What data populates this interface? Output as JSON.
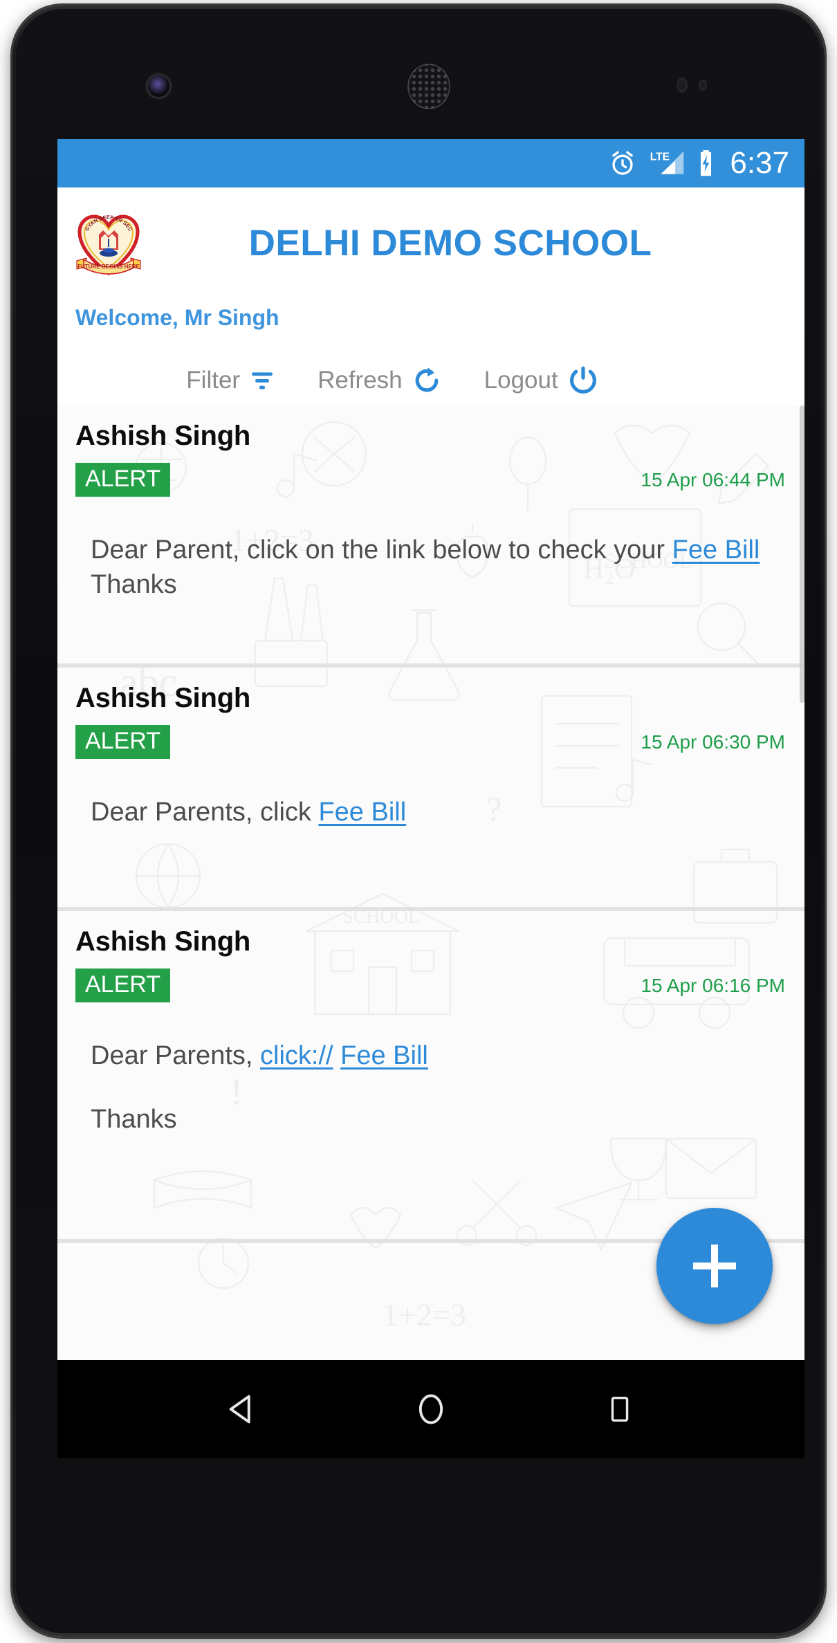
{
  "device": {
    "hardware": {
      "front_camera": "front-camera",
      "earpiece": "earpiece-speaker",
      "proximity_sensor": "proximity-sensor",
      "light_sensor": "light-sensor"
    }
  },
  "status_bar": {
    "background_color": "#3190d9",
    "clock": "6:37",
    "icons": [
      {
        "name": "alarm-icon",
        "label": "alarm"
      },
      {
        "name": "lte-signal-icon",
        "label": "LTE"
      },
      {
        "name": "battery-charging-icon",
        "label": "battery charging"
      }
    ],
    "network_type": "LTE"
  },
  "header": {
    "logo": {
      "name": "school-crest-logo",
      "top_text": "GYAN DEEP SR SEC SCHOOL",
      "ribbon_text": "FUTURE BEGINS HERE"
    },
    "title": "DELHI DEMO SCHOOL",
    "title_color": "#2d8ad8"
  },
  "welcome": {
    "text": "Welcome, Mr Singh",
    "color": "#3e95dd"
  },
  "toolbar": {
    "actions": [
      {
        "label": "Filter",
        "icon": "filter-icon"
      },
      {
        "label": "Refresh",
        "icon": "refresh-icon"
      },
      {
        "label": "Logout",
        "icon": "power-icon"
      }
    ]
  },
  "messages": [
    {
      "sender": "Ashish Singh",
      "badge": "ALERT",
      "badge_color": "#24a148",
      "timestamp": "15 Apr 06:44 PM",
      "timestamp_color": "#1e9e4a",
      "body_parts": [
        [
          {
            "type": "text",
            "value": "Dear Parent, click on the link below to check your "
          },
          {
            "type": "link",
            "value": "Fee Bill"
          },
          {
            "type": "text",
            "value": " Thanks"
          }
        ]
      ]
    },
    {
      "sender": "Ashish Singh",
      "badge": "ALERT",
      "badge_color": "#24a148",
      "timestamp": "15 Apr 06:30 PM",
      "timestamp_color": "#1e9e4a",
      "body_parts": [
        [
          {
            "type": "text",
            "value": "Dear Parents, click "
          },
          {
            "type": "link",
            "value": "Fee Bill"
          }
        ]
      ]
    },
    {
      "sender": "Ashish Singh",
      "badge": "ALERT",
      "badge_color": "#24a148",
      "timestamp": "15 Apr 06:16 PM",
      "timestamp_color": "#1e9e4a",
      "body_parts": [
        [
          {
            "type": "text",
            "value": "Dear Parents, "
          },
          {
            "type": "link",
            "value": "click://"
          },
          {
            "type": "text",
            "value": " "
          },
          {
            "type": "link",
            "value": "Fee Bill"
          }
        ],
        [
          {
            "type": "text",
            "value": "Thanks"
          }
        ]
      ]
    }
  ],
  "fab": {
    "name": "add-message-button",
    "icon": "plus-icon",
    "color": "#2d8ad8"
  },
  "nav_bar": {
    "buttons": [
      {
        "name": "nav-back-button",
        "icon": "triangle-back-icon"
      },
      {
        "name": "nav-home-button",
        "icon": "circle-home-icon"
      },
      {
        "name": "nav-recents-button",
        "icon": "square-recents-icon"
      }
    ]
  }
}
